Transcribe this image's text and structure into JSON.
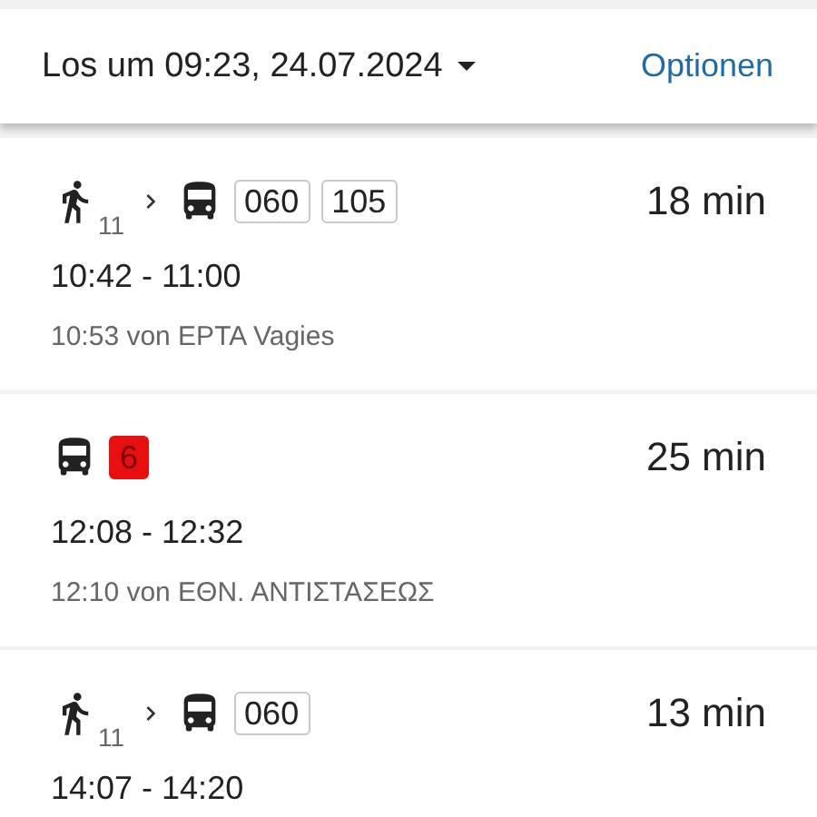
{
  "header": {
    "departure": "Los um 09:23, 24.07.2024",
    "options": "Optionen"
  },
  "routes": [
    {
      "legs": [
        {
          "kind": "walk",
          "minutes": "11"
        },
        {
          "kind": "bus",
          "lines": [
            {
              "label": "060",
              "color": "#ffffff"
            },
            {
              "label": "105",
              "color": "#ffffff"
            }
          ]
        }
      ],
      "duration": "18 min",
      "times": "10:42 - 11:00",
      "departure_info": "10:53 von EPTA Vagies"
    },
    {
      "legs": [
        {
          "kind": "bus",
          "lines": [
            {
              "label": "6",
              "color": "#e8100e"
            }
          ]
        }
      ],
      "duration": "25 min",
      "times": "12:08 - 12:32",
      "departure_info": "12:10 von ΕΘΝ. ΑΝΤΙΣΤΑΣΕΩΣ"
    },
    {
      "legs": [
        {
          "kind": "walk",
          "minutes": "11"
        },
        {
          "kind": "bus",
          "lines": [
            {
              "label": "060",
              "color": "#ffffff"
            }
          ]
        }
      ],
      "duration": "13 min",
      "times": "14:07 - 14:20"
    }
  ]
}
